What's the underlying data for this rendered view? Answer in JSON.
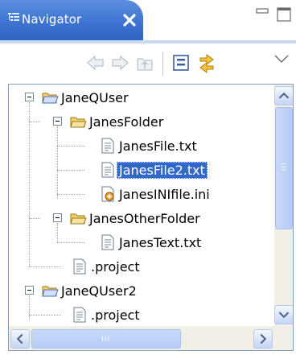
{
  "tab": {
    "title": "Navigator",
    "icon": "navigator-view-icon",
    "close_icon": "close-icon"
  },
  "window_controls": [
    "minimize-icon",
    "maximize-icon"
  ],
  "toolbar": {
    "buttons": [
      "back-arrow-icon",
      "forward-arrow-icon",
      "up-folder-icon",
      "collapse-all-icon",
      "link-with-editor-icon",
      "view-menu-chevron-icon"
    ]
  },
  "tree": {
    "items": [
      {
        "label": "JaneQUser",
        "type": "project-folder",
        "expanded": true
      },
      {
        "label": "JanesFolder",
        "type": "folder",
        "expanded": true
      },
      {
        "label": "JanesFile.txt",
        "type": "text-file"
      },
      {
        "label": "JanesFile2.txt",
        "type": "text-file",
        "selected": true
      },
      {
        "label": "JanesINIfile.ini",
        "type": "ini-file"
      },
      {
        "label": "JanesOtherFolder",
        "type": "folder",
        "expanded": true
      },
      {
        "label": "JanesText.txt",
        "type": "text-file"
      },
      {
        "label": ".project",
        "type": "text-file"
      },
      {
        "label": "JaneQUser2",
        "type": "project-folder",
        "expanded": true
      },
      {
        "label": ".project",
        "type": "text-file"
      }
    ]
  },
  "colors": {
    "tab_active": "#3f74d2",
    "selection": "#316ac5",
    "panel_border": "#7f9db9",
    "scrollbar_track": "#f1efe6"
  }
}
